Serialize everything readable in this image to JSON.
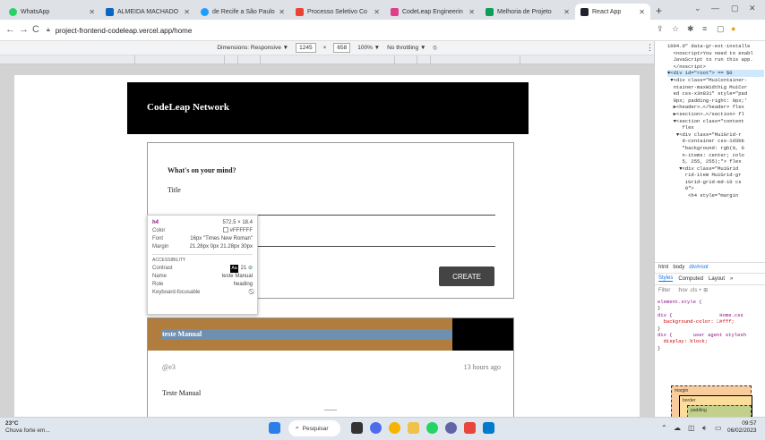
{
  "colors": {
    "tabbar": "#dee1e6",
    "header_black": "#000000",
    "create_button": "#444444",
    "margin_highlight": "#b07d3e",
    "content_highlight": "#6f8fb1",
    "link_blue": "#1a73e8"
  },
  "tabs": [
    {
      "label": "WhatsApp",
      "icon": "whatsapp-icon",
      "color": "#25d366"
    },
    {
      "label": "ALMEIDA MACHADO",
      "icon": "linkedin-icon",
      "color": "#0a66c2"
    },
    {
      "label": "de Recife a São Paulo",
      "icon": "circle-icon",
      "color": "#1a9fff"
    },
    {
      "label": "Processo Seletivo Co",
      "icon": "gmail-icon",
      "color": "#ea4335"
    },
    {
      "label": "CodeLeap Engineerin",
      "icon": "notion-icon",
      "color": "#e03e8a"
    },
    {
      "label": "Melhoria de Projeto",
      "icon": "sheets-icon",
      "color": "#0f9d58"
    },
    {
      "label": "React App",
      "icon": "react-icon",
      "color": "#20232a"
    }
  ],
  "address": {
    "url": "project-frontend-codeleap.vercel.app/home"
  },
  "devbar": {
    "dimensions_label": "Dimensions: Responsive ▼",
    "width": "1245",
    "times": "×",
    "height": "658",
    "zoom": "100% ▼",
    "throttling": "No throttling ▼"
  },
  "app": {
    "header_title": "CodeLeap Network",
    "form": {
      "heading": "What's on your mind?",
      "title_label": "Title",
      "create_label": "CREATE"
    },
    "post": {
      "title": "teste Manual",
      "username": "@e3",
      "time": "13 hours ago",
      "content": "Teste Manual"
    }
  },
  "tooltip": {
    "tag": "h4",
    "size": "572.5 × 18.4",
    "rows": [
      {
        "k": "Color",
        "v": "#FFFFFF"
      },
      {
        "k": "Font",
        "v": "16px \"Times New Roman\""
      },
      {
        "k": "Margin",
        "v": "21.28px 0px 21.28px 30px"
      }
    ],
    "accessibility_label": "ACCESSIBILITY",
    "contrast_label": "Contrast",
    "contrast_value": "21",
    "contrast_badge": "Aa",
    "name_label": "Name",
    "name_value": "teste Manual",
    "role_label": "Role",
    "role_value": "heading",
    "focus_label": "Keyboard-focusable",
    "focus_value": "⃠"
  },
  "devtools": {
    "dom_lines": [
      "1094.0\" data-gr-ext-installe",
      "  <noscript>You need to enabl",
      "  JavaScript to run this app.",
      "  </noscript>",
      "▼<div id=\"root\"> == $0",
      " ▼<div class=\"MuiContainer-",
      "  ntainer-maxWidthLg MuiCor",
      "  ed css-x3n831\" style=\"pad",
      "  0px; padding-right: 0px;'",
      "  ▶<header>…</header> flex",
      "  ▶<section>…</section> fl",
      "  ▼<section class=\"content",
      "     flex",
      "   ▼<div class=\"MuiGrid-r",
      "     d-container css-1d3bb",
      "     \"background: rgb(0, 0",
      "     n-items: center; colo",
      "     5, 255, 255);\"> flex",
      "    ▼<div class=\"MuiGrid",
      "      rid-item MuiGrid-gr",
      "      iGrid-grid-md-10 cs",
      "      9\">",
      "       <h4 style=\"margin"
    ],
    "breadcrumbs": [
      "html",
      "body",
      "div#root"
    ],
    "style_tabs": [
      "Styles",
      "Computed",
      "Layout",
      "»"
    ],
    "filter_placeholder": "Filter",
    "filter_tools": ":hov .cls + ⊞",
    "style_lines": [
      "element.style {",
      "}",
      "div {                Home.css",
      "  background-color: □#fff;",
      "}",
      "div {       user agent stylesh",
      "  display: block;",
      "}"
    ],
    "box": {
      "margin": "margin",
      "border": "border",
      "padding": "padding",
      "dash": "–"
    }
  },
  "taskbar": {
    "temp": "23°C",
    "weather": "Chuva forte em...",
    "search_label": "Pesquisar",
    "time": "09:57",
    "date": "06/02/2023"
  }
}
